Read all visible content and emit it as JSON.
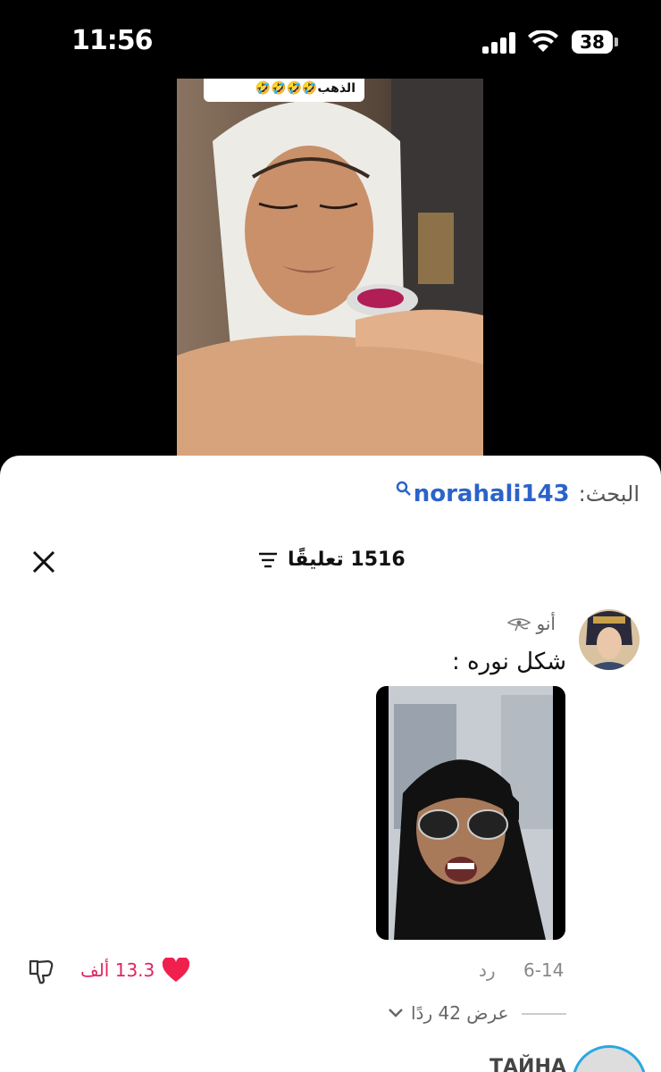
{
  "status_bar": {
    "time": "11:56",
    "battery": "38"
  },
  "video": {
    "caption": "الذهب🤣🤣🤣🤣"
  },
  "search": {
    "prefix": "البحث:",
    "term": "norahali143"
  },
  "comments_header": {
    "count_label": "1516 تعليقًا"
  },
  "comment": {
    "username": "أنو",
    "text": "شكل نوره :",
    "date": "6-14",
    "reply_label": "رد",
    "likes": "13.3 ألف",
    "view_replies_label": "عرض 42 ردًا"
  },
  "next_comment": {
    "username": "ТАЙНА"
  },
  "colors": {
    "accent": "#e0245e",
    "link": "#2b63c9"
  }
}
